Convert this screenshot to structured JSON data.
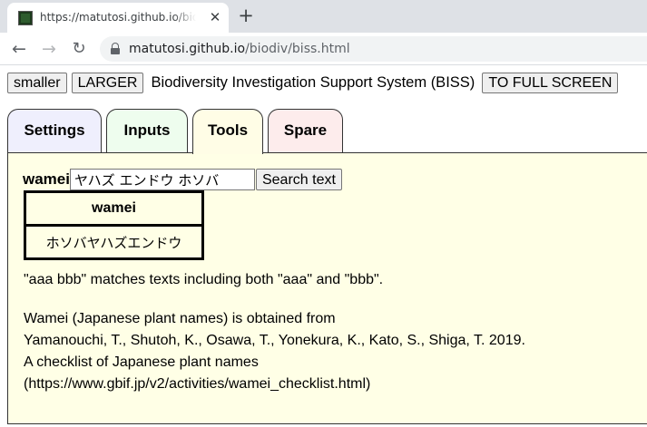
{
  "browser": {
    "tab_title": "https://matutosi.github.io/biodiv",
    "tab_close": "✕",
    "new_tab": "+",
    "url_host": "matutosi.github.io",
    "url_path": "/biodiv/biss.html",
    "icons": {
      "back": "back-arrow-icon",
      "forward": "forward-arrow-icon",
      "reload": "reload-icon",
      "lock": "lock-icon"
    }
  },
  "header": {
    "smaller_label": "smaller",
    "larger_label": "LARGER",
    "title": "Biodiversity Investigation Support System (BISS)",
    "fullscreen_label": "TO FULL SCREEN"
  },
  "tabs": [
    {
      "label": "Settings",
      "color": "#efeffd"
    },
    {
      "label": "Inputs",
      "color": "#eefdee"
    },
    {
      "label": "Tools",
      "color": "#fffde6",
      "active": true
    },
    {
      "label": "Spare",
      "color": "#fdecec"
    }
  ],
  "tools": {
    "search_label": "wamei",
    "search_value": "ヤハズ エンドウ ホソバ",
    "search_button": "Search text",
    "table": {
      "header": "wamei",
      "rows": [
        "ホソバヤハズエンドウ"
      ]
    },
    "note": "\"aaa bbb\" matches texts including both \"aaa\" and \"bbb\".",
    "citation": [
      "Wamei (Japanese plant names) is obtained from",
      "Yamanouchi, T., Shutoh, K., Osawa, T., Yonekura, K., Kato, S., Shiga, T. 2019.",
      "A checklist of Japanese plant names",
      "(https://www.gbif.jp/v2/activities/wamei_checklist.html)"
    ]
  }
}
